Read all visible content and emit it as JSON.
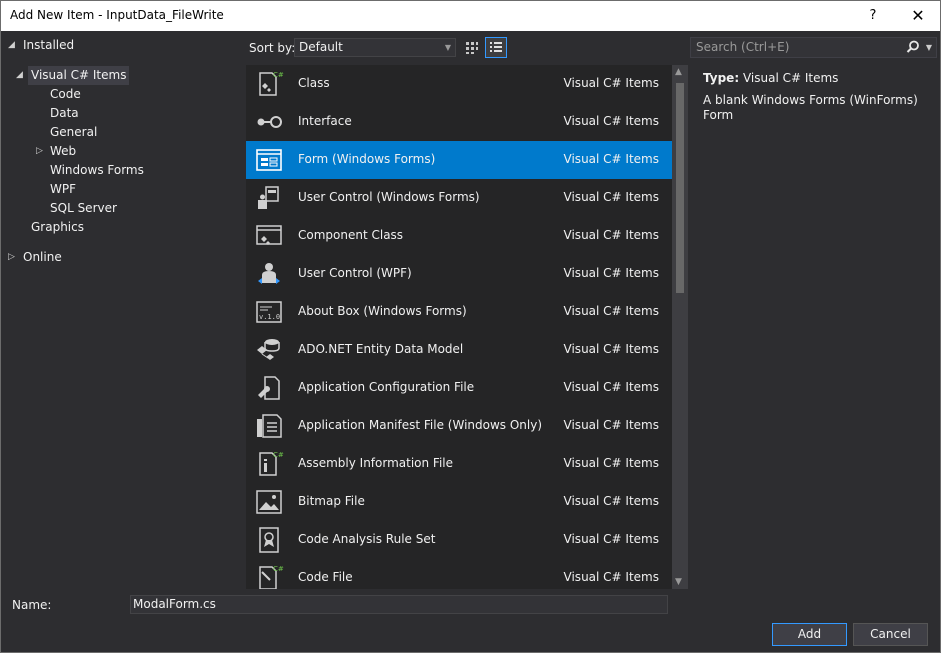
{
  "window": {
    "title": "Add New Item - InputData_FileWrite",
    "help": "?",
    "close": "✕"
  },
  "tree": {
    "installed": "Installed",
    "visual_csharp": "Visual C# Items",
    "children": [
      "Code",
      "Data",
      "General",
      "Web",
      "Windows Forms",
      "WPF",
      "SQL Server"
    ],
    "graphics": "Graphics",
    "online": "Online"
  },
  "toolbar": {
    "sort_label": "Sort by:",
    "sort_value": "Default"
  },
  "search": {
    "placeholder": "Search (Ctrl+E)"
  },
  "items": [
    {
      "name": "Class",
      "category": "Visual C# Items",
      "icon": "class-icon"
    },
    {
      "name": "Interface",
      "category": "Visual C# Items",
      "icon": "interface-icon"
    },
    {
      "name": "Form (Windows Forms)",
      "category": "Visual C# Items",
      "icon": "form-icon",
      "selected": true
    },
    {
      "name": "User Control (Windows Forms)",
      "category": "Visual C# Items",
      "icon": "user-control-icon"
    },
    {
      "name": "Component Class",
      "category": "Visual C# Items",
      "icon": "component-class-icon"
    },
    {
      "name": "User Control (WPF)",
      "category": "Visual C# Items",
      "icon": "wpf-user-control-icon"
    },
    {
      "name": "About Box (Windows Forms)",
      "category": "Visual C# Items",
      "icon": "about-box-icon"
    },
    {
      "name": "ADO.NET Entity Data Model",
      "category": "Visual C# Items",
      "icon": "entity-model-icon"
    },
    {
      "name": "Application Configuration File",
      "category": "Visual C# Items",
      "icon": "config-file-icon"
    },
    {
      "name": "Application Manifest File (Windows Only)",
      "category": "Visual C# Items",
      "icon": "manifest-file-icon"
    },
    {
      "name": "Assembly Information File",
      "category": "Visual C# Items",
      "icon": "assembly-info-icon"
    },
    {
      "name": "Bitmap File",
      "category": "Visual C# Items",
      "icon": "bitmap-file-icon"
    },
    {
      "name": "Code Analysis Rule Set",
      "category": "Visual C# Items",
      "icon": "rule-set-icon"
    },
    {
      "name": "Code File",
      "category": "Visual C# Items",
      "icon": "code-file-icon"
    }
  ],
  "details": {
    "type_label": "Type:",
    "type_value": "Visual C# Items",
    "description": "A blank Windows Forms (WinForms) Form"
  },
  "bottom": {
    "name_label": "Name:",
    "name_value": "ModalForm.cs",
    "add_label": "Add",
    "cancel_label": "Cancel"
  }
}
